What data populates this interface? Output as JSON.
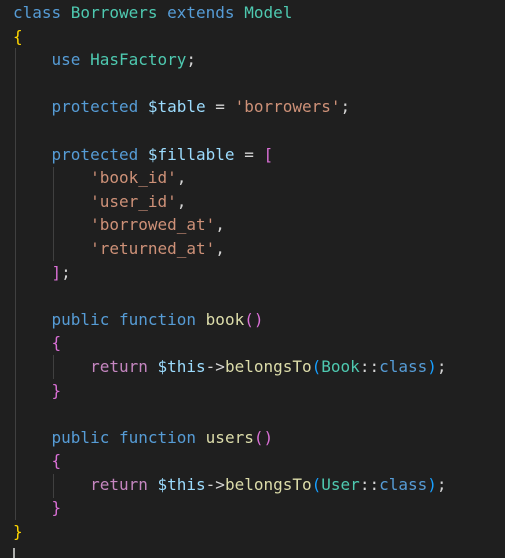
{
  "editor": {
    "lines": [
      [
        {
          "t": "class ",
          "c": "tok-kw"
        },
        {
          "t": "Borrowers ",
          "c": "tok-class"
        },
        {
          "t": "extends ",
          "c": "tok-kw"
        },
        {
          "t": "Model",
          "c": "tok-class"
        }
      ],
      [
        {
          "t": "{",
          "c": "b1"
        }
      ],
      [
        {
          "t": "    "
        },
        {
          "t": "use ",
          "c": "tok-kw"
        },
        {
          "t": "HasFactory",
          "c": "tok-class"
        },
        {
          "t": ";",
          "c": "tok-op"
        }
      ],
      [],
      [
        {
          "t": "    "
        },
        {
          "t": "protected ",
          "c": "tok-kw"
        },
        {
          "t": "$table",
          "c": "tok-var"
        },
        {
          "t": " = ",
          "c": "tok-op"
        },
        {
          "t": "'borrowers'",
          "c": "tok-str"
        },
        {
          "t": ";",
          "c": "tok-op"
        }
      ],
      [],
      [
        {
          "t": "    "
        },
        {
          "t": "protected ",
          "c": "tok-kw"
        },
        {
          "t": "$fillable",
          "c": "tok-var"
        },
        {
          "t": " = ",
          "c": "tok-op"
        },
        {
          "t": "[",
          "c": "b2"
        }
      ],
      [
        {
          "t": "        "
        },
        {
          "t": "'book_id'",
          "c": "tok-str"
        },
        {
          "t": ",",
          "c": "tok-op"
        }
      ],
      [
        {
          "t": "        "
        },
        {
          "t": "'user_id'",
          "c": "tok-str"
        },
        {
          "t": ",",
          "c": "tok-op"
        }
      ],
      [
        {
          "t": "        "
        },
        {
          "t": "'borrowed_at'",
          "c": "tok-str"
        },
        {
          "t": ",",
          "c": "tok-op"
        }
      ],
      [
        {
          "t": "        "
        },
        {
          "t": "'returned_at'",
          "c": "tok-str"
        },
        {
          "t": ",",
          "c": "tok-op"
        }
      ],
      [
        {
          "t": "    "
        },
        {
          "t": "]",
          "c": "b2"
        },
        {
          "t": ";",
          "c": "tok-op"
        }
      ],
      [],
      [
        {
          "t": "    "
        },
        {
          "t": "public ",
          "c": "tok-kw"
        },
        {
          "t": "function ",
          "c": "tok-kw"
        },
        {
          "t": "book",
          "c": "tok-fn"
        },
        {
          "t": "()",
          "c": "b2"
        }
      ],
      [
        {
          "t": "    "
        },
        {
          "t": "{",
          "c": "b2"
        }
      ],
      [
        {
          "t": "        "
        },
        {
          "t": "return ",
          "c": "tok-ctrl"
        },
        {
          "t": "$this",
          "c": "tok-var"
        },
        {
          "t": "->",
          "c": "tok-op"
        },
        {
          "t": "belongsTo",
          "c": "tok-fn"
        },
        {
          "t": "(",
          "c": "b3"
        },
        {
          "t": "Book",
          "c": "tok-class"
        },
        {
          "t": "::",
          "c": "tok-op"
        },
        {
          "t": "class",
          "c": "tok-kw"
        },
        {
          "t": ")",
          "c": "b3"
        },
        {
          "t": ";",
          "c": "tok-op"
        }
      ],
      [
        {
          "t": "    "
        },
        {
          "t": "}",
          "c": "b2"
        }
      ],
      [],
      [
        {
          "t": "    "
        },
        {
          "t": "public ",
          "c": "tok-kw"
        },
        {
          "t": "function ",
          "c": "tok-kw"
        },
        {
          "t": "users",
          "c": "tok-fn"
        },
        {
          "t": "()",
          "c": "b2"
        }
      ],
      [
        {
          "t": "    "
        },
        {
          "t": "{",
          "c": "b2"
        }
      ],
      [
        {
          "t": "        "
        },
        {
          "t": "return ",
          "c": "tok-ctrl"
        },
        {
          "t": "$this",
          "c": "tok-var"
        },
        {
          "t": "->",
          "c": "tok-op"
        },
        {
          "t": "belongsTo",
          "c": "tok-fn"
        },
        {
          "t": "(",
          "c": "b3"
        },
        {
          "t": "User",
          "c": "tok-class"
        },
        {
          "t": "::",
          "c": "tok-op"
        },
        {
          "t": "class",
          "c": "tok-kw"
        },
        {
          "t": ")",
          "c": "b3"
        },
        {
          "t": ";",
          "c": "tok-op"
        }
      ],
      [
        {
          "t": "    "
        },
        {
          "t": "}",
          "c": "b2"
        }
      ],
      [
        {
          "t": "}",
          "c": "b1"
        }
      ]
    ]
  }
}
